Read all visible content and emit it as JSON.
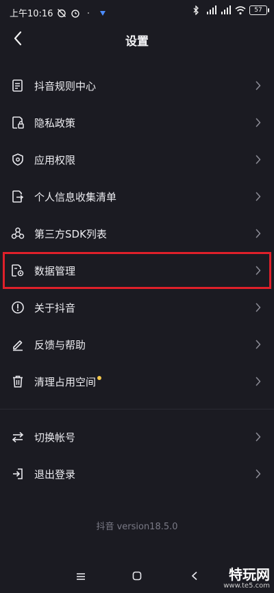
{
  "status_bar": {
    "time": "上午10:16",
    "battery": "57"
  },
  "header": {
    "title": "设置",
    "back_icon": "chevron-left-icon"
  },
  "menu": {
    "items": [
      {
        "label": "抖音规则中心",
        "icon": "document-list-icon"
      },
      {
        "label": "隐私政策",
        "icon": "privacy-lock-file-icon"
      },
      {
        "label": "应用权限",
        "icon": "shield-check-icon"
      },
      {
        "label": "个人信息收集清单",
        "icon": "file-export-icon"
      },
      {
        "label": "第三方SDK列表",
        "icon": "sdk-triangle-icon"
      },
      {
        "label": "数据管理",
        "icon": "data-gear-file-icon",
        "highlighted": true
      },
      {
        "label": "关于抖音",
        "icon": "info-circle-icon"
      },
      {
        "label": "反馈与帮助",
        "icon": "edit-pencil-icon"
      },
      {
        "label": "清理占用空间",
        "icon": "trash-icon",
        "badge": "yellow-dot"
      },
      {
        "label": "切换帐号",
        "icon": "switch-arrows-icon"
      },
      {
        "label": "退出登录",
        "icon": "logout-icon"
      }
    ]
  },
  "version_text": "抖音 version18.5.0",
  "watermark": {
    "title": "特玩网",
    "subtitle": "www.te5.com"
  },
  "colors": {
    "background": "#1b1b22",
    "highlight_border": "#e0202a",
    "badge_dot": "#f5c84c"
  }
}
